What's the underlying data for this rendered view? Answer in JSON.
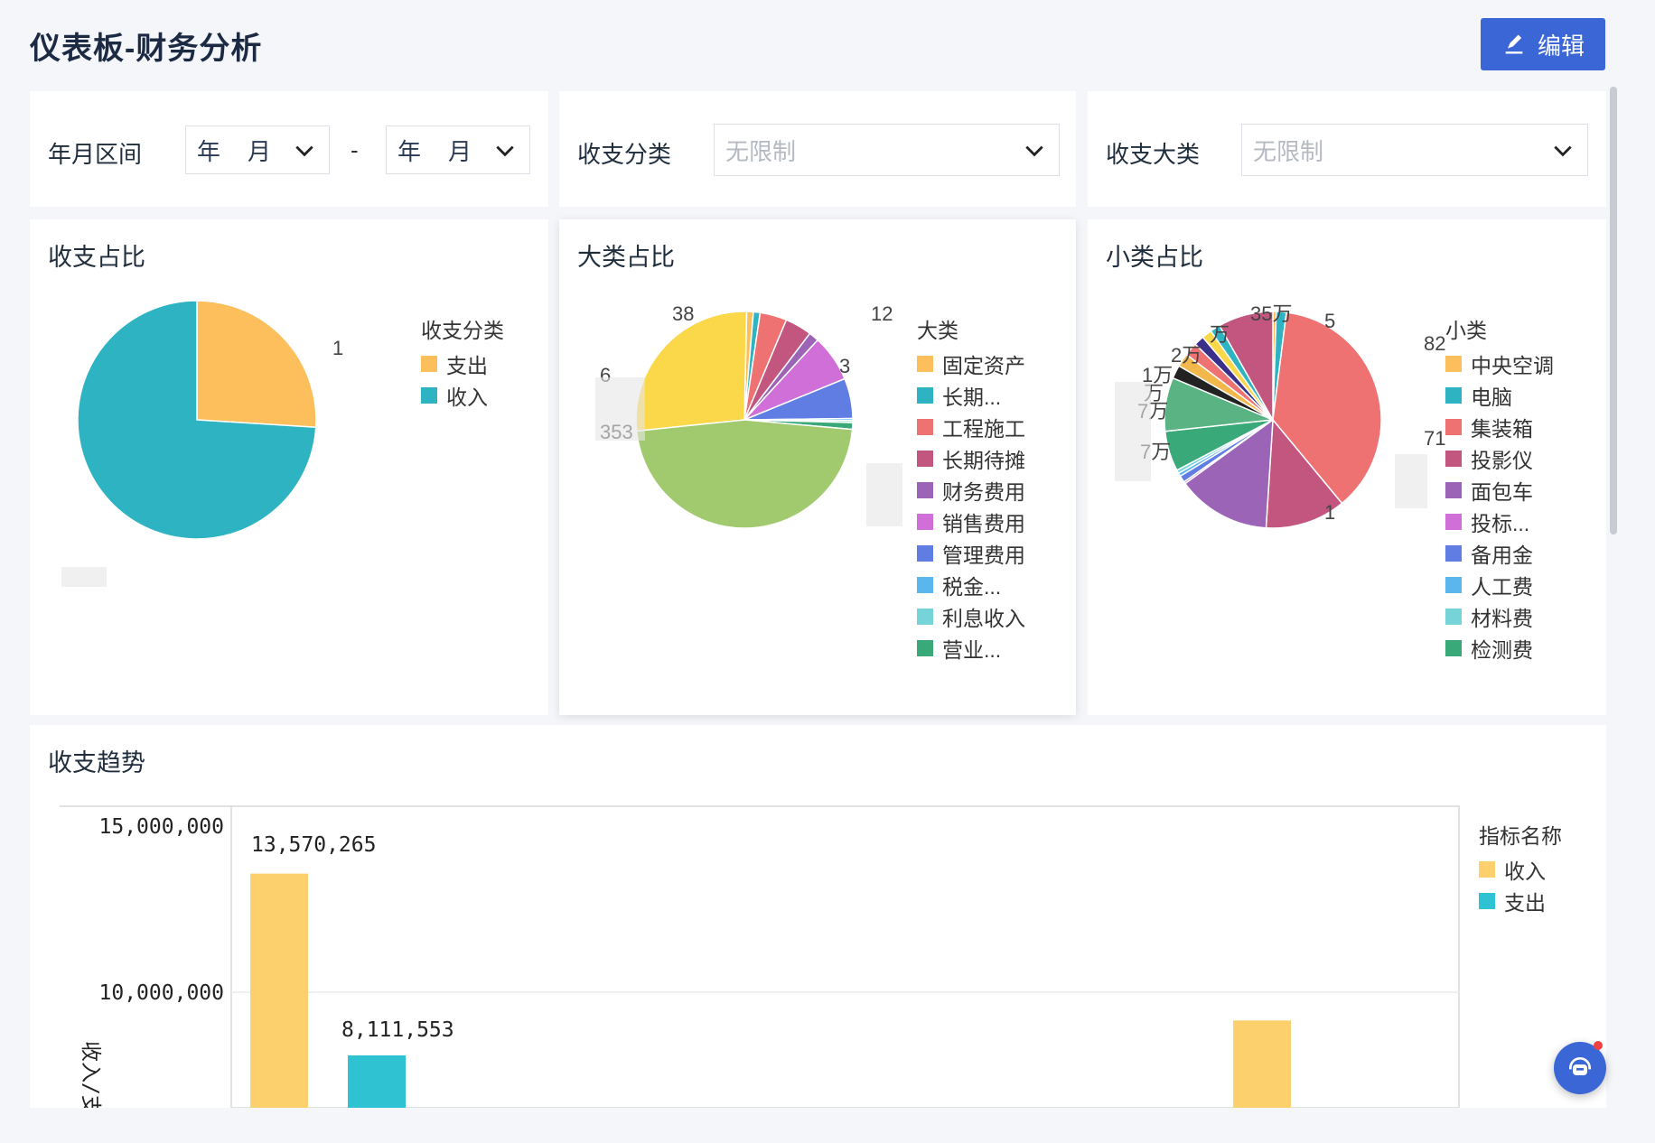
{
  "page": {
    "title": "仪表板-财务分析",
    "edit_label": "编辑"
  },
  "filters": {
    "date_range": {
      "label": "年月区间",
      "start_year": "年",
      "start_month": "月",
      "separator": "-",
      "end_year": "年",
      "end_month": "月"
    },
    "category": {
      "label": "收支分类",
      "placeholder": "无限制"
    },
    "major_category": {
      "label": "收支大类",
      "placeholder": "无限制"
    }
  },
  "cards": {
    "ratio": {
      "title": "收支占比",
      "legend_title": "收支分类"
    },
    "major": {
      "title": "大类占比",
      "legend_title": "大类"
    },
    "minor": {
      "title": "小类占比",
      "legend_title": "小类"
    },
    "trend": {
      "title": "收支趋势",
      "legend_title": "指标名称"
    }
  },
  "colors": {
    "accent": "#3a66d6",
    "orange": "#fcbf5c",
    "teal": "#2db3c1"
  },
  "chart_data": [
    {
      "type": "pie",
      "title": "收支占比",
      "legend_title": "收支分类",
      "legend_position": "right",
      "series": [
        {
          "name": "支出",
          "value": 26,
          "color": "#fcbf5c"
        },
        {
          "name": "收入",
          "value": 74,
          "color": "#2db3c1"
        }
      ],
      "slice_labels": [
        "1"
      ]
    },
    {
      "type": "pie",
      "title": "大类占比",
      "legend_title": "大类",
      "legend_position": "right",
      "series": [
        {
          "name": "固定资产",
          "value": 1,
          "color": "#fcbf5c"
        },
        {
          "name": "长期...",
          "value": 1,
          "color": "#2db3c1"
        },
        {
          "name": "工程施工",
          "value": 4,
          "color": "#ef7272"
        },
        {
          "name": "长期待摊",
          "value": 4,
          "color": "#c2567e"
        },
        {
          "name": "财务费用",
          "value": 1.5,
          "color": "#9b64b6"
        },
        {
          "name": "销售费用",
          "value": 7,
          "color": "#d06fd7"
        },
        {
          "name": "管理费用",
          "value": 6,
          "color": "#5f7de3"
        },
        {
          "name": "税金...",
          "value": 0.3,
          "color": "#5bb6ee"
        },
        {
          "name": "利息收入",
          "value": 0.3,
          "color": "#76d4d8"
        },
        {
          "name": "营业...",
          "value": 1,
          "color": "#3aa97a"
        },
        {
          "name": "",
          "value": 47,
          "color": "#a1ca6e"
        },
        {
          "name": "",
          "value": 27,
          "color": "#fad84a"
        }
      ],
      "slice_labels": [
        "38",
        "12",
        "3",
        "6",
        "353"
      ]
    },
    {
      "type": "pie",
      "title": "小类占比",
      "legend_title": "小类",
      "legend_position": "right",
      "series": [
        {
          "name": "中央空调",
          "value": 0.5,
          "color": "#fcbf5c"
        },
        {
          "name": "电脑",
          "value": 1.5,
          "color": "#2db3c1"
        },
        {
          "name": "集装箱",
          "value": 37,
          "color": "#ef7272"
        },
        {
          "name": "投影仪",
          "value": 12,
          "color": "#c2567e"
        },
        {
          "name": "面包车",
          "value": 14,
          "color": "#9b64b6"
        },
        {
          "name": "投标...",
          "value": 0.3,
          "color": "#d06fd7"
        },
        {
          "name": "备用金",
          "value": 1,
          "color": "#5f7de3"
        },
        {
          "name": "人工费",
          "value": 0.5,
          "color": "#5bb6ee"
        },
        {
          "name": "材料费",
          "value": 0.5,
          "color": "#76d4d8"
        },
        {
          "name": "检测费",
          "value": 6,
          "color": "#3aa97a"
        },
        {
          "name": "",
          "value": 8,
          "color": "#5ab383"
        },
        {
          "name": "",
          "value": 2,
          "color": "#222222"
        },
        {
          "name": "",
          "value": 2,
          "color": "#f2b84b"
        },
        {
          "name": "",
          "value": 2,
          "color": "#ef7272"
        },
        {
          "name": "",
          "value": 1.5,
          "color": "#3b2f8c"
        },
        {
          "name": "",
          "value": 1.5,
          "color": "#fad84a"
        },
        {
          "name": "",
          "value": 1.5,
          "color": "#2db3c1"
        },
        {
          "name": "",
          "value": 8.2,
          "color": "#c2567e"
        }
      ],
      "slice_labels": [
        "35万",
        "5",
        "万",
        "2万",
        "1万",
        "万",
        "7万",
        "7万",
        "82",
        "71",
        "1"
      ]
    },
    {
      "type": "bar",
      "title": "收支趋势",
      "legend_title": "指标名称",
      "legend_position": "right",
      "ylabel": "收入/支",
      "y_ticks": [
        "15,000,000",
        "10,000,000"
      ],
      "ylim": [
        0,
        16000000
      ],
      "series": [
        {
          "name": "收入",
          "color": "#fcd06c",
          "values": [
            13570265,
            null,
            9150000
          ]
        },
        {
          "name": "支出",
          "color": "#2fc2d3",
          "values": [
            null,
            8100000,
            null
          ]
        }
      ],
      "bar_labels": [
        "13,570,265",
        "8,111,553"
      ]
    }
  ]
}
